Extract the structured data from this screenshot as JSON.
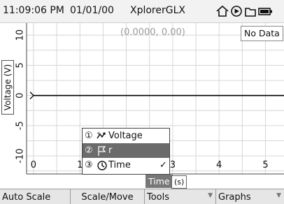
{
  "status_bar": {
    "time": "11:09:06 PM",
    "date": "01/01/00",
    "app_name": "XplorerGLX",
    "icons": [
      "home-icon",
      "play-icon",
      "folder-icon",
      "battery-icon"
    ]
  },
  "graph": {
    "coord_readout": "(0.0000, 0.00)",
    "no_data": "No Data",
    "y_axis_label": "Voltage (V)",
    "x_axis_label": "Time",
    "x_axis_unit": "(s)",
    "y_ticks": [
      "10",
      "5",
      "0",
      "-5",
      "-10"
    ],
    "x_ticks": [
      "0",
      "1",
      "2",
      "3",
      "4",
      "5"
    ],
    "y_range": [
      -13,
      12
    ],
    "x_range": [
      -0.15,
      5.4
    ],
    "series": [
      {
        "name": "Voltage",
        "values": [
          [
            0,
            0
          ],
          [
            5.4,
            0
          ]
        ]
      }
    ],
    "colors": {
      "trace": "#000000",
      "grid": "#d6d6d6"
    }
  },
  "axis_menu": {
    "items": [
      {
        "number": "①",
        "icon": "voltage-sensor-icon",
        "label": "Voltage",
        "checked": false,
        "selected": false
      },
      {
        "number": "②",
        "icon": "flag-icon",
        "label": "r",
        "checked": false,
        "selected": true
      },
      {
        "number": "③",
        "icon": "clock-icon",
        "label": "Time",
        "checked": true,
        "selected": false
      }
    ],
    "check_mark": "✓"
  },
  "softkeys": [
    "Auto Scale",
    "Scale/Move",
    "Tools",
    "Graphs"
  ]
}
